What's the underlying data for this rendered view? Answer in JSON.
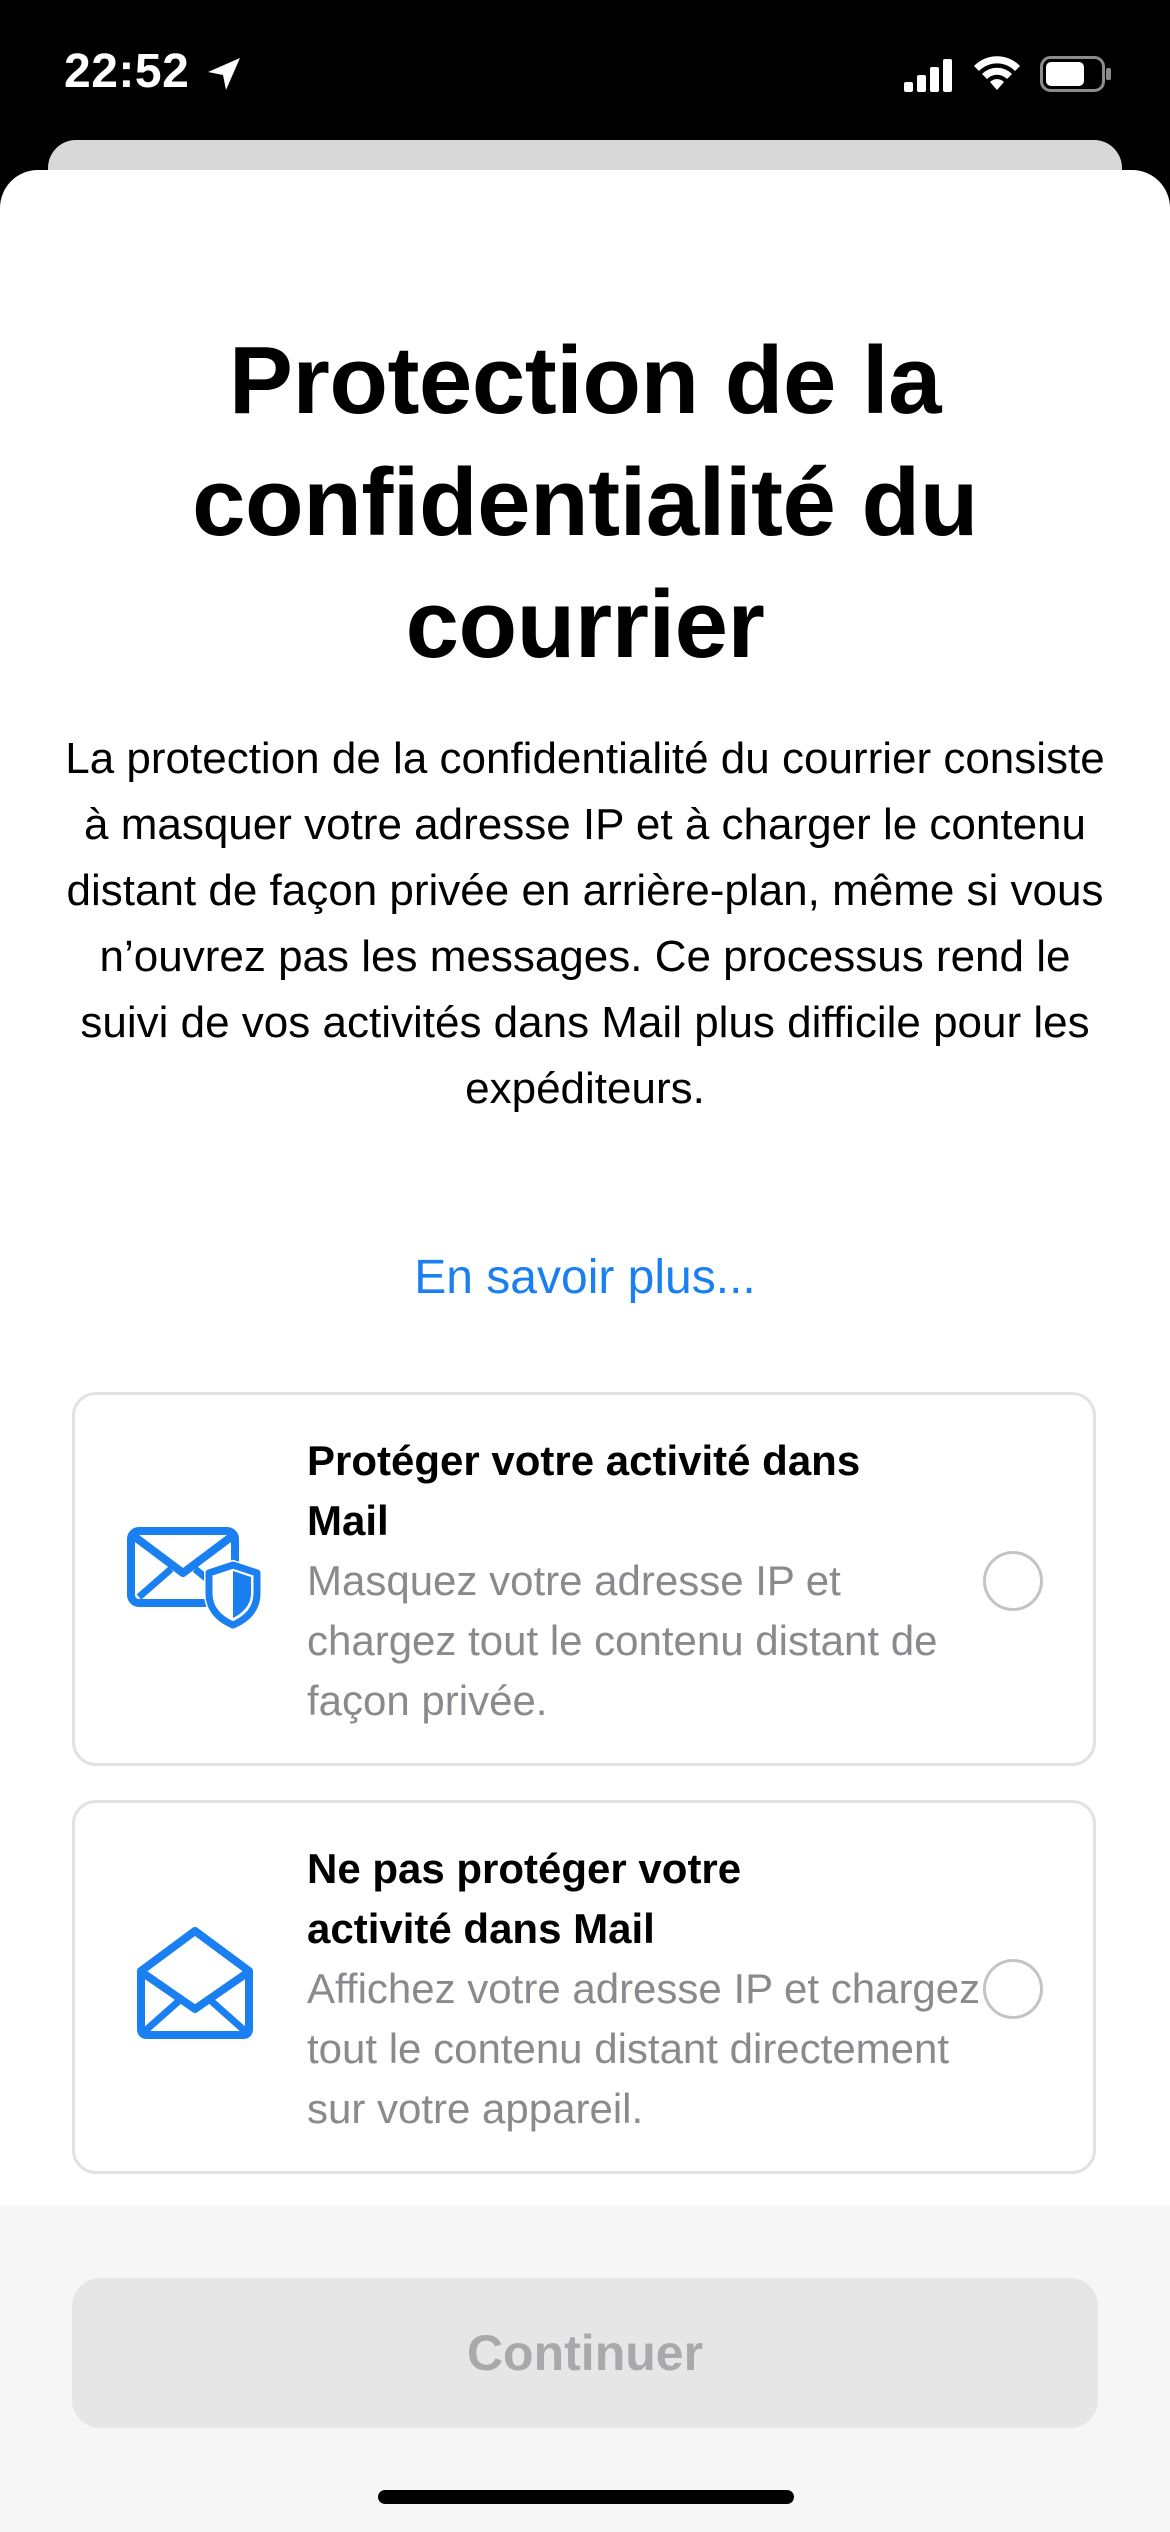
{
  "status_bar": {
    "time": "22:52",
    "icons": [
      "location-arrow-icon",
      "signal-icon",
      "wifi-icon",
      "battery-icon"
    ]
  },
  "sheet": {
    "title": "Protection de la confidentialité du courrier",
    "description": "La protection de la confidentialité du courrier consiste à masquer votre adresse IP et à charger le contenu distant de façon privée en arrière-plan, même si vous n’ouvrez pas les messages. Ce processus rend le suivi de vos activités dans Mail plus difficile pour les expéditeurs.",
    "learn_more": "En savoir plus..."
  },
  "options": [
    {
      "title": "Protéger votre activité dans Mail",
      "description": "Masquez votre adresse IP et chargez tout le contenu distant de façon privée.",
      "icon": "envelope-shield-icon",
      "selected": false
    },
    {
      "title": "Ne pas protéger votre activité dans Mail",
      "description": "Affichez votre adresse IP et chargez tout le contenu distant directement sur votre appareil.",
      "icon": "envelope-open-icon",
      "selected": false
    }
  ],
  "footer": {
    "continue_label": "Continuer"
  },
  "colors": {
    "accent": "#1a7ff0",
    "secondary_text": "#8a8a8e",
    "button_disabled_bg": "#e6e6e6",
    "button_disabled_text": "#a9a9ab"
  }
}
